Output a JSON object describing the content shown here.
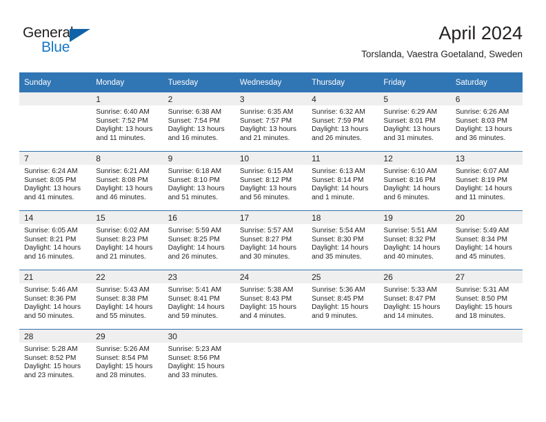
{
  "branding": {
    "logo_text_primary": "General",
    "logo_text_secondary": "Blue",
    "logo_triangle_color": "#1063a8",
    "logo_blue_color": "#1576c4"
  },
  "header": {
    "month_title": "April 2024",
    "location": "Torslanda, Vaestra Goetaland, Sweden",
    "header_bg_color": "#3075b4",
    "daynum_bg_color": "#efefef",
    "week_separator_color": "#2f6fa8"
  },
  "weekday_headers": [
    "Sunday",
    "Monday",
    "Tuesday",
    "Wednesday",
    "Thursday",
    "Friday",
    "Saturday"
  ],
  "weeks": [
    [
      {
        "day": "",
        "lines": []
      },
      {
        "day": "1",
        "lines": [
          "Sunrise: 6:40 AM",
          "Sunset: 7:52 PM",
          "Daylight: 13 hours",
          "and 11 minutes."
        ]
      },
      {
        "day": "2",
        "lines": [
          "Sunrise: 6:38 AM",
          "Sunset: 7:54 PM",
          "Daylight: 13 hours",
          "and 16 minutes."
        ]
      },
      {
        "day": "3",
        "lines": [
          "Sunrise: 6:35 AM",
          "Sunset: 7:57 PM",
          "Daylight: 13 hours",
          "and 21 minutes."
        ]
      },
      {
        "day": "4",
        "lines": [
          "Sunrise: 6:32 AM",
          "Sunset: 7:59 PM",
          "Daylight: 13 hours",
          "and 26 minutes."
        ]
      },
      {
        "day": "5",
        "lines": [
          "Sunrise: 6:29 AM",
          "Sunset: 8:01 PM",
          "Daylight: 13 hours",
          "and 31 minutes."
        ]
      },
      {
        "day": "6",
        "lines": [
          "Sunrise: 6:26 AM",
          "Sunset: 8:03 PM",
          "Daylight: 13 hours",
          "and 36 minutes."
        ]
      }
    ],
    [
      {
        "day": "7",
        "lines": [
          "Sunrise: 6:24 AM",
          "Sunset: 8:05 PM",
          "Daylight: 13 hours",
          "and 41 minutes."
        ]
      },
      {
        "day": "8",
        "lines": [
          "Sunrise: 6:21 AM",
          "Sunset: 8:08 PM",
          "Daylight: 13 hours",
          "and 46 minutes."
        ]
      },
      {
        "day": "9",
        "lines": [
          "Sunrise: 6:18 AM",
          "Sunset: 8:10 PM",
          "Daylight: 13 hours",
          "and 51 minutes."
        ]
      },
      {
        "day": "10",
        "lines": [
          "Sunrise: 6:15 AM",
          "Sunset: 8:12 PM",
          "Daylight: 13 hours",
          "and 56 minutes."
        ]
      },
      {
        "day": "11",
        "lines": [
          "Sunrise: 6:13 AM",
          "Sunset: 8:14 PM",
          "Daylight: 14 hours",
          "and 1 minute."
        ]
      },
      {
        "day": "12",
        "lines": [
          "Sunrise: 6:10 AM",
          "Sunset: 8:16 PM",
          "Daylight: 14 hours",
          "and 6 minutes."
        ]
      },
      {
        "day": "13",
        "lines": [
          "Sunrise: 6:07 AM",
          "Sunset: 8:19 PM",
          "Daylight: 14 hours",
          "and 11 minutes."
        ]
      }
    ],
    [
      {
        "day": "14",
        "lines": [
          "Sunrise: 6:05 AM",
          "Sunset: 8:21 PM",
          "Daylight: 14 hours",
          "and 16 minutes."
        ]
      },
      {
        "day": "15",
        "lines": [
          "Sunrise: 6:02 AM",
          "Sunset: 8:23 PM",
          "Daylight: 14 hours",
          "and 21 minutes."
        ]
      },
      {
        "day": "16",
        "lines": [
          "Sunrise: 5:59 AM",
          "Sunset: 8:25 PM",
          "Daylight: 14 hours",
          "and 26 minutes."
        ]
      },
      {
        "day": "17",
        "lines": [
          "Sunrise: 5:57 AM",
          "Sunset: 8:27 PM",
          "Daylight: 14 hours",
          "and 30 minutes."
        ]
      },
      {
        "day": "18",
        "lines": [
          "Sunrise: 5:54 AM",
          "Sunset: 8:30 PM",
          "Daylight: 14 hours",
          "and 35 minutes."
        ]
      },
      {
        "day": "19",
        "lines": [
          "Sunrise: 5:51 AM",
          "Sunset: 8:32 PM",
          "Daylight: 14 hours",
          "and 40 minutes."
        ]
      },
      {
        "day": "20",
        "lines": [
          "Sunrise: 5:49 AM",
          "Sunset: 8:34 PM",
          "Daylight: 14 hours",
          "and 45 minutes."
        ]
      }
    ],
    [
      {
        "day": "21",
        "lines": [
          "Sunrise: 5:46 AM",
          "Sunset: 8:36 PM",
          "Daylight: 14 hours",
          "and 50 minutes."
        ]
      },
      {
        "day": "22",
        "lines": [
          "Sunrise: 5:43 AM",
          "Sunset: 8:38 PM",
          "Daylight: 14 hours",
          "and 55 minutes."
        ]
      },
      {
        "day": "23",
        "lines": [
          "Sunrise: 5:41 AM",
          "Sunset: 8:41 PM",
          "Daylight: 14 hours",
          "and 59 minutes."
        ]
      },
      {
        "day": "24",
        "lines": [
          "Sunrise: 5:38 AM",
          "Sunset: 8:43 PM",
          "Daylight: 15 hours",
          "and 4 minutes."
        ]
      },
      {
        "day": "25",
        "lines": [
          "Sunrise: 5:36 AM",
          "Sunset: 8:45 PM",
          "Daylight: 15 hours",
          "and 9 minutes."
        ]
      },
      {
        "day": "26",
        "lines": [
          "Sunrise: 5:33 AM",
          "Sunset: 8:47 PM",
          "Daylight: 15 hours",
          "and 14 minutes."
        ]
      },
      {
        "day": "27",
        "lines": [
          "Sunrise: 5:31 AM",
          "Sunset: 8:50 PM",
          "Daylight: 15 hours",
          "and 18 minutes."
        ]
      }
    ],
    [
      {
        "day": "28",
        "lines": [
          "Sunrise: 5:28 AM",
          "Sunset: 8:52 PM",
          "Daylight: 15 hours",
          "and 23 minutes."
        ]
      },
      {
        "day": "29",
        "lines": [
          "Sunrise: 5:26 AM",
          "Sunset: 8:54 PM",
          "Daylight: 15 hours",
          "and 28 minutes."
        ]
      },
      {
        "day": "30",
        "lines": [
          "Sunrise: 5:23 AM",
          "Sunset: 8:56 PM",
          "Daylight: 15 hours",
          "and 33 minutes."
        ]
      },
      {
        "day": "",
        "lines": []
      },
      {
        "day": "",
        "lines": []
      },
      {
        "day": "",
        "lines": []
      },
      {
        "day": "",
        "lines": []
      }
    ]
  ]
}
